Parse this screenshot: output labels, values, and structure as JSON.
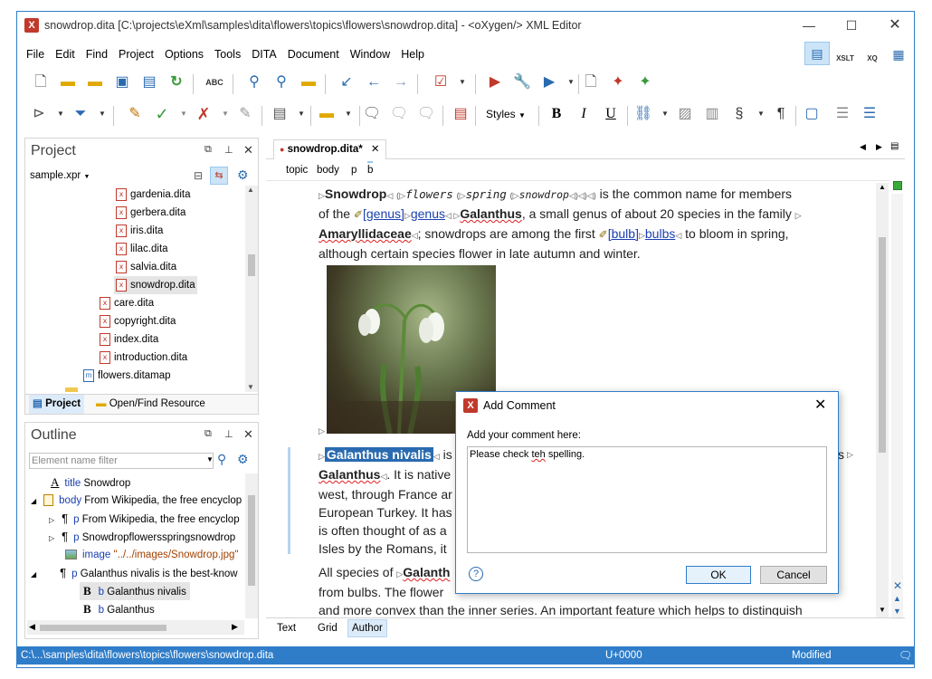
{
  "window": {
    "title": "snowdrop.dita [C:\\projects\\eXml\\samples\\dita\\flowers\\topics\\flowers\\snowdrop.dita] - <oXygen/> XML Editor"
  },
  "menu": [
    "File",
    "Edit",
    "Find",
    "Project",
    "Options",
    "Tools",
    "DITA",
    "Document",
    "Window",
    "Help"
  ],
  "toolbar": {
    "styles_label": "Styles",
    "xslt_label": "XSLT",
    "xq_label": "XQ"
  },
  "project": {
    "title": "Project",
    "file": "sample.xpr",
    "items": [
      {
        "label": "gardenia.dita",
        "type": "dita"
      },
      {
        "label": "gerbera.dita",
        "type": "dita"
      },
      {
        "label": "iris.dita",
        "type": "dita"
      },
      {
        "label": "lilac.dita",
        "type": "dita"
      },
      {
        "label": "salvia.dita",
        "type": "dita"
      },
      {
        "label": "snowdrop.dita",
        "type": "dita",
        "selected": true
      },
      {
        "label": "care.dita",
        "type": "dita"
      },
      {
        "label": "copyright.dita",
        "type": "dita"
      },
      {
        "label": "index.dita",
        "type": "dita"
      },
      {
        "label": "introduction.dita",
        "type": "dita"
      },
      {
        "label": "flowers.ditamap",
        "type": "map"
      }
    ],
    "tabs": [
      "Project",
      "Open/Find Resource"
    ]
  },
  "outline": {
    "title": "Outline",
    "filter_placeholder": "Element name filter",
    "rows": [
      {
        "icon": "A",
        "tag": "title",
        "text": "Snowdrop"
      },
      {
        "icon": "body",
        "tag": "body",
        "text": "From Wikipedia, the free encyclop"
      },
      {
        "icon": "¶",
        "tag": "p",
        "text": "From Wikipedia, the free encyclop"
      },
      {
        "icon": "¶",
        "tag": "p",
        "text": "Snowdropflowersspringsnowdrop"
      },
      {
        "icon": "img",
        "tag": "image",
        "text": "\"../../images/Snowdrop.jpg\""
      },
      {
        "icon": "¶",
        "tag": "p",
        "text": "Galanthus nivalis is the best-know"
      },
      {
        "icon": "B",
        "tag": "b",
        "text": "Galanthus nivalis"
      },
      {
        "icon": "B",
        "tag": "b",
        "text": "Galanthus"
      }
    ]
  },
  "editor": {
    "tab": "snowdrop.dita*",
    "breadcrumb": [
      "topic",
      "body",
      "p",
      "b"
    ],
    "p1": {
      "snowdrop": "Snowdrop",
      "flowers": "flowers",
      "spring": "spring",
      "snowdrop_kw": "snowdrop",
      "t1": "is the common name for members",
      "t2": "of the",
      "genus_ref": "[genus]",
      "genus": "genus",
      "galanthus": "Galanthus",
      "t3": ", a small genus of about 20 species in the family",
      "amaryllidaceae": "Amaryllidaceae",
      "t4": "; snowdrops are among the first",
      "bulb_ref": "[bulb]",
      "bulbs": "bulbs",
      "t5": "to bloom in spring,",
      "t6": "although certain species flower in late autumn and winter."
    },
    "p2": {
      "galanthus_nivalis": "Galanthus nivalis",
      "is": "is",
      "s_end": "s",
      "galanthus": "Galanthus",
      "l1": ". It is native",
      "l2": "west, through France ar",
      "l3": "European Turkey. It has",
      "l4": "is often thought of as a",
      "l5": "Isles by the Romans, it"
    },
    "p3": {
      "l1a": "All species of",
      "galanth": "Galanth",
      "l2": "from bulbs. The flower",
      "l3": "and more convex than the inner series. An important feature which helps to distinguish"
    },
    "bottom_tabs": [
      "Text",
      "Grid",
      "Author"
    ]
  },
  "dialog": {
    "title": "Add Comment",
    "prompt": "Add your comment here:",
    "comment_pre": "Please check",
    "comment_err": "teh",
    "comment_post": "spelling.",
    "ok": "OK",
    "cancel": "Cancel"
  },
  "status": {
    "path": "C:\\...\\samples\\dita\\flowers\\topics\\flowers\\snowdrop.dita",
    "char": "U+0000",
    "state": "Modified"
  }
}
